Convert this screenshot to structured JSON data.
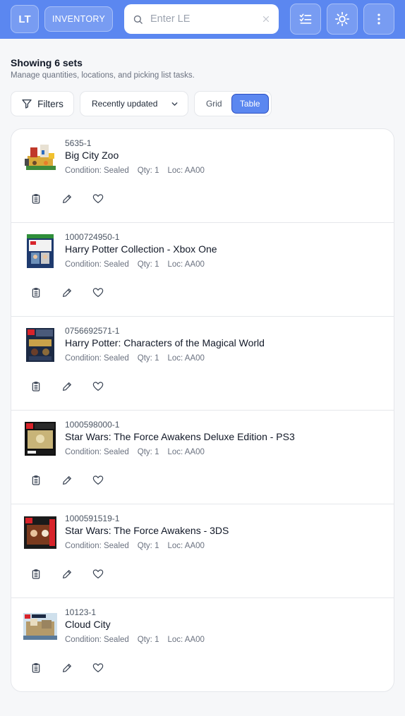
{
  "header": {
    "logo": "LT",
    "inventory_label": "INVENTORY",
    "search_placeholder": "Enter LE",
    "search_value": "",
    "icons": [
      "search-icon",
      "clear-icon",
      "checklist-icon",
      "sun-icon",
      "more-vertical-icon"
    ]
  },
  "summary": {
    "title": "Showing 6 sets",
    "subtitle": "Manage quantities, locations, and picking list tasks."
  },
  "controls": {
    "filters_label": "Filters",
    "sort_selected": "Recently updated",
    "view_options": [
      "Grid",
      "Table"
    ],
    "view_selected": "Table"
  },
  "items": [
    {
      "set_number": "5635-1",
      "name": "Big City Zoo",
      "condition": "Condition: Sealed",
      "qty": "Qty: 1",
      "loc": "Loc: AA00"
    },
    {
      "set_number": "1000724950-1",
      "name": "Harry Potter Collection - Xbox One",
      "condition": "Condition: Sealed",
      "qty": "Qty: 1",
      "loc": "Loc: AA00"
    },
    {
      "set_number": "0756692571-1",
      "name": "Harry Potter: Characters of the Magical World",
      "condition": "Condition: Sealed",
      "qty": "Qty: 1",
      "loc": "Loc: AA00"
    },
    {
      "set_number": "1000598000-1",
      "name": "Star Wars: The Force Awakens Deluxe Edition - PS3",
      "condition": "Condition: Sealed",
      "qty": "Qty: 1",
      "loc": "Loc: AA00"
    },
    {
      "set_number": "1000591519-1",
      "name": "Star Wars: The Force Awakens - 3DS",
      "condition": "Condition: Sealed",
      "qty": "Qty: 1",
      "loc": "Loc: AA00"
    },
    {
      "set_number": "10123-1",
      "name": "Cloud City",
      "condition": "Condition: Sealed",
      "qty": "Qty: 1",
      "loc": "Loc: AA00"
    }
  ],
  "item_actions": [
    "clipboard-icon",
    "pencil-icon",
    "heart-icon"
  ],
  "colors": {
    "accent": "#5b87f0",
    "accent_border": "#2b4fc2"
  }
}
